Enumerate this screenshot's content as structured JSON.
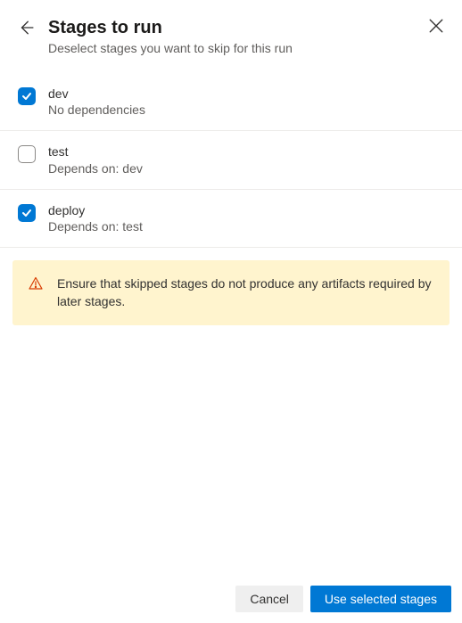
{
  "header": {
    "title": "Stages to run",
    "subtitle": "Deselect stages you want to skip for this run"
  },
  "stages": [
    {
      "name": "dev",
      "dependency": "No dependencies",
      "checked": true
    },
    {
      "name": "test",
      "dependency": "Depends on: dev",
      "checked": false
    },
    {
      "name": "deploy",
      "dependency": "Depends on: test",
      "checked": true
    }
  ],
  "warning": {
    "text": "Ensure that skipped stages do not produce any artifacts required by later stages."
  },
  "footer": {
    "cancel_label": "Cancel",
    "confirm_label": "Use selected stages"
  },
  "colors": {
    "primary": "#0078d4",
    "warning_bg": "#fff4ce",
    "warning_icon": "#d83b01"
  }
}
